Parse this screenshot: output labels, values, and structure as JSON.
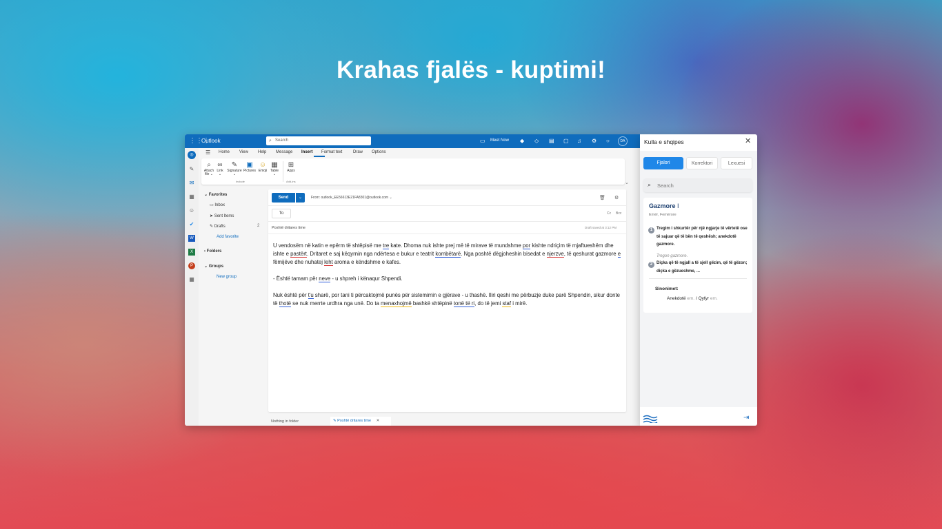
{
  "headline": "Krahas fjalës - kuptimi!",
  "outlook": {
    "brand": "Outlook",
    "search_placeholder": "Search",
    "meet_now": "Meet Now",
    "avatar": "DA",
    "menu_tabs": [
      "Home",
      "View",
      "Help",
      "Message",
      "Insert",
      "Format text",
      "Draw",
      "Options"
    ],
    "active_tab": "Insert",
    "ribbon": {
      "attach_file": "Attach file",
      "link": "Link",
      "signature": "Signature",
      "pictures": "Pictures",
      "emoji": "Emoji",
      "table": "Table",
      "apps": "Apps",
      "group_include": "Include",
      "group_addins": "Add-ins"
    },
    "folders": {
      "favorites": "Favorites",
      "inbox": "Inbox",
      "sent_items": "Sent Items",
      "drafts": "Drafts",
      "drafts_count": "2",
      "add_favorite": "Add favorite",
      "folders": "Folders",
      "groups": "Groups",
      "new_group": "New group"
    },
    "compose": {
      "send": "Send",
      "from": "From: outlook_EE56613E21FA8301@outlook.com",
      "to": "To",
      "cc": "Cc",
      "bcc": "Bcc",
      "subject": "Poshtë dritares time",
      "draft_saved": "Draft saved at 3:12 PM"
    },
    "bottom": {
      "nothing_in_folder": "Nothing in folder",
      "draft_tab": "Poshtë dritares time"
    }
  },
  "addin": {
    "title": "Kulla e shqipes",
    "tabs": [
      "Fjalori",
      "Korrektori",
      "Lexuesi"
    ],
    "search_placeholder": "Search",
    "entry": {
      "word": "Gazmore",
      "roman": "I",
      "pos": "Emër, Femërore",
      "def1": "Tregim i shkurtër për një ngjarje të vërtetë ose të sajuar që të bën të qeshësh; anekdotë gazmore.",
      "example": "Tregon gazmore.",
      "def2": "Diçka që të ngjall a të sjell gëzim, që të gëzon; diçka e gëzueshme, ...",
      "synonyms_label": "Sinonimet:",
      "syn1": "Anekdotë",
      "syn1_pos": "em.",
      "separator": "/",
      "syn2": "Qyfyr",
      "syn2_pos": "em."
    }
  },
  "colors": {
    "outlook_blue": "#0f6cbd",
    "addin_tab_blue": "#1f87e8",
    "spell_red": "#d83b3b",
    "grammar_blue": "#2b5ad8",
    "style_yellow": "#f2b705"
  }
}
